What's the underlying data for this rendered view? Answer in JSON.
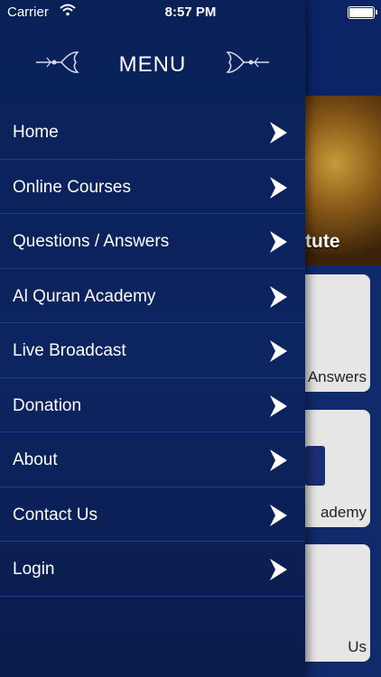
{
  "status_bar": {
    "carrier": "Carrier",
    "time": "8:57 PM"
  },
  "menu": {
    "title": "MENU",
    "items": [
      {
        "label": "Home"
      },
      {
        "label": "Online Courses"
      },
      {
        "label": "Questions / Answers"
      },
      {
        "label": "Al Quran Academy"
      },
      {
        "label": "Live Broadcast"
      },
      {
        "label": "Donation"
      },
      {
        "label": "About"
      },
      {
        "label": "Contact Us"
      },
      {
        "label": "Login"
      }
    ]
  },
  "background": {
    "banner_partial_text": "tute",
    "tiles": [
      {
        "label": "Answers"
      },
      {
        "label": "ademy"
      },
      {
        "label": "Us"
      }
    ]
  },
  "colors": {
    "drawer_bg": "#0c2460",
    "divider": "#1d3f8a",
    "text": "#ffffff",
    "tile_bg": "#e6e6e6"
  }
}
